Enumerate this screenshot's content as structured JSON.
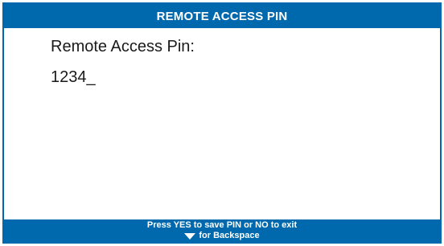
{
  "header": {
    "title": "REMOTE ACCESS PIN"
  },
  "main": {
    "label": "Remote Access Pin:",
    "pin_value": "1234_"
  },
  "footer": {
    "line1": "Press YES to save PIN or NO to exit",
    "line2": "for Backspace",
    "line2_icon": "down-triangle-icon"
  },
  "colors": {
    "accent": "#0068ad",
    "text": "#1a1a1a",
    "background": "#ffffff"
  }
}
